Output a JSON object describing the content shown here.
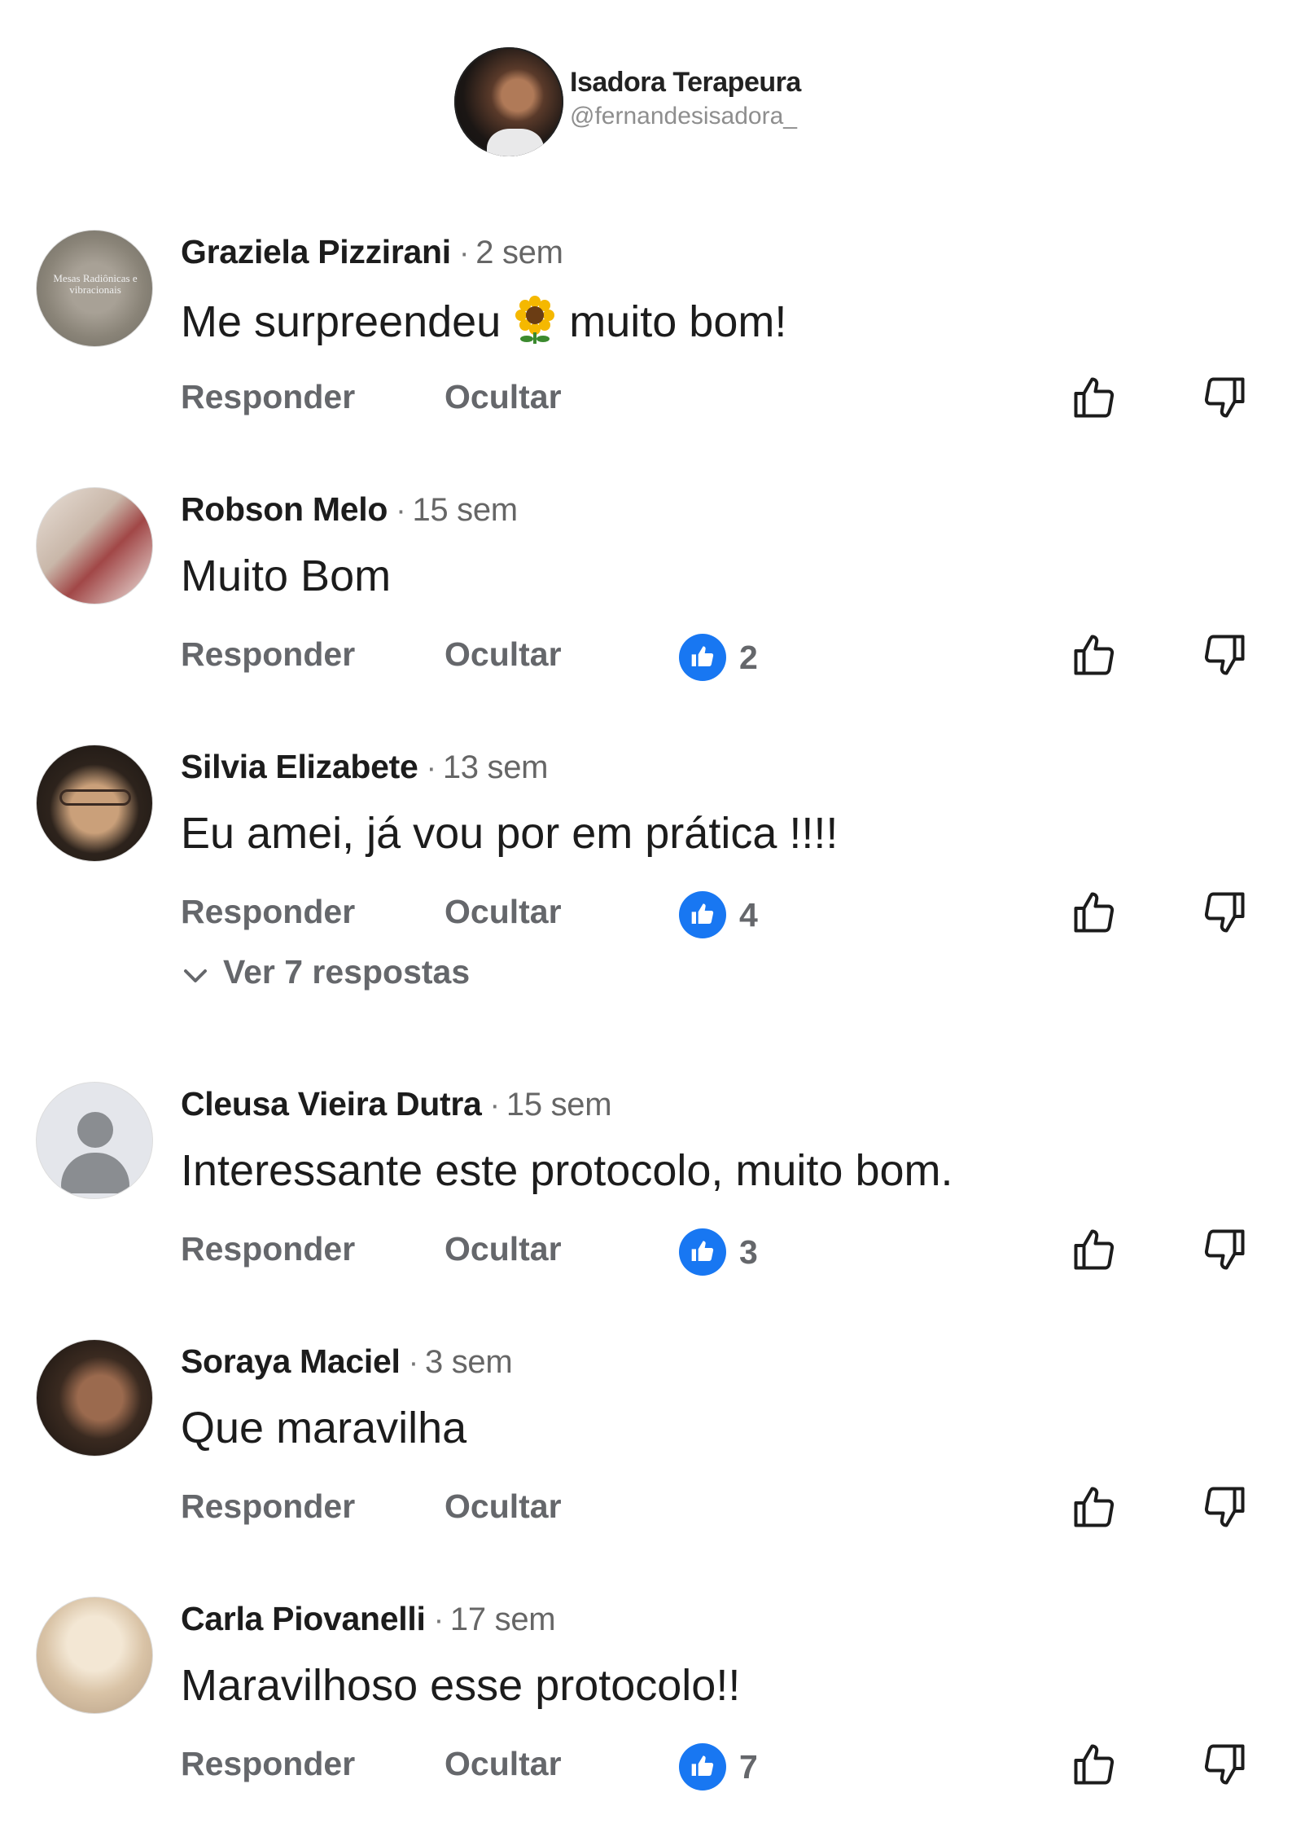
{
  "profile": {
    "name": "Isadora Terapeura",
    "handle": "@fernandesisadora_"
  },
  "actions": {
    "reply": "Responder",
    "hide": "Ocultar"
  },
  "colors": {
    "like_blue": "#1877f2",
    "action_gray": "#65676b"
  },
  "comments": [
    {
      "author": "Graziela Pizzirani",
      "separator": "·",
      "time": "2 sem",
      "text_before": "Me surpreendeu",
      "emoji": "sunflower",
      "text_after": "muito bom!",
      "avatar_text": "Mesas Radiônicas e vibracionais"
    },
    {
      "author": "Robson Melo",
      "separator": "·",
      "time": "15 sem",
      "text": "Muito Bom",
      "likes": "2"
    },
    {
      "author": "Silvia Elizabete",
      "separator": "·",
      "time": "13 sem",
      "text": "Eu amei, já vou por em prática !!!!",
      "likes": "4",
      "replies": "Ver 7 respostas"
    },
    {
      "author": "Cleusa Vieira Dutra",
      "separator": "·",
      "time": "15 sem",
      "text": "Interessante este protocolo, muito bom.",
      "likes": "3"
    },
    {
      "author": "Soraya Maciel",
      "separator": "·",
      "time": "3 sem",
      "text": "Que maravilha"
    },
    {
      "author": "Carla Piovanelli",
      "separator": "·",
      "time": "17 sem",
      "text": "Maravilhoso esse protocolo!!",
      "likes": "7"
    }
  ]
}
